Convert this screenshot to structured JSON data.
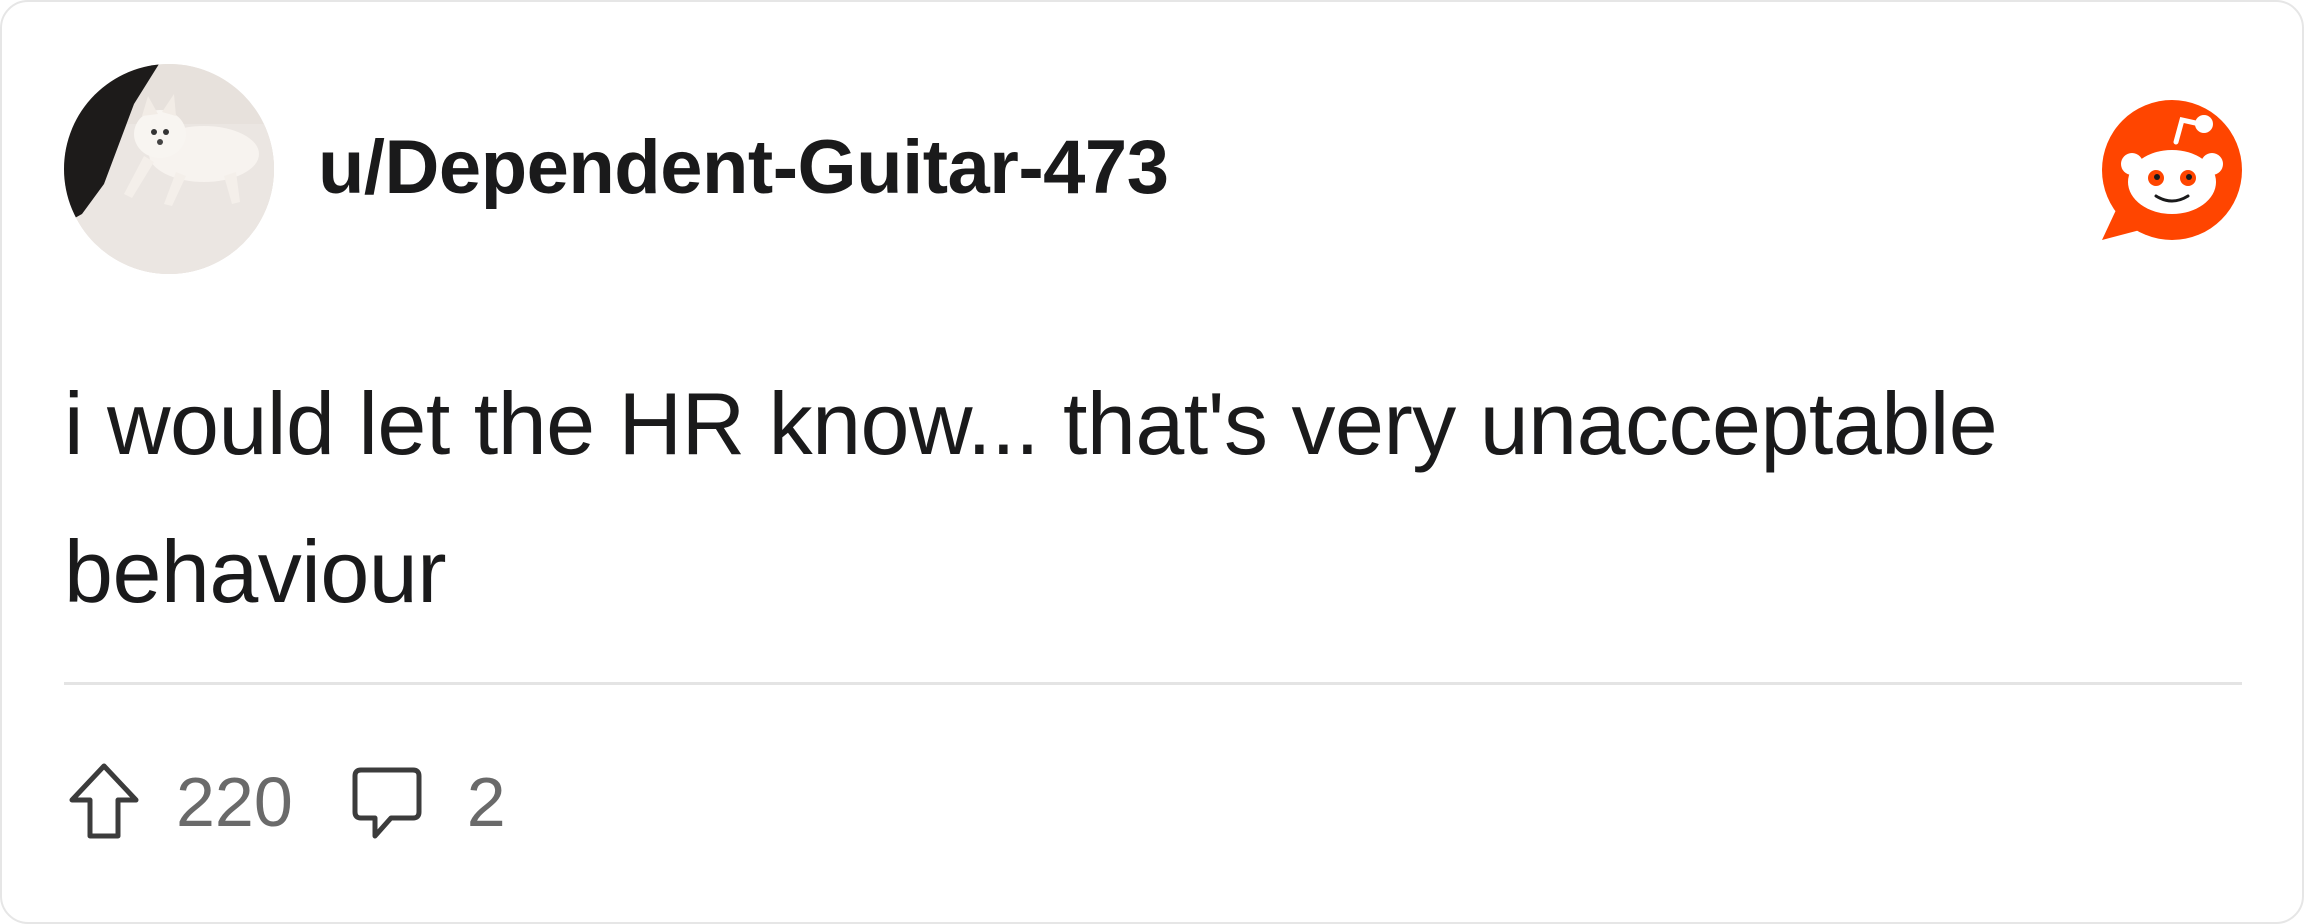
{
  "post": {
    "username": "u/Dependent-Guitar-473",
    "body": "i would let the HR know... that's very unacceptable behaviour",
    "upvotes": "220",
    "comments": "2"
  },
  "icons": {
    "avatar": "avatar-dog-photo",
    "brand": "reddit-snoo-icon",
    "upvote": "upvote-arrow-icon",
    "comment": "comment-bubble-icon"
  },
  "colors": {
    "brand": "#FF4500",
    "text": "#1a1a1b",
    "muted": "#6a6a6a",
    "divider": "#e4e4e4"
  }
}
